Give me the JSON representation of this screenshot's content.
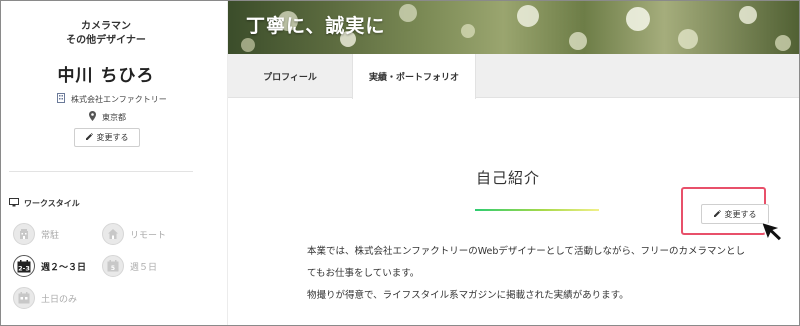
{
  "profile": {
    "job_line1": "カメラマン",
    "job_line2": "その他デザイナー",
    "name": "中川 ちひろ",
    "company": "株式会社エンファクトリー",
    "location": "東京都",
    "edit_label": "変更する"
  },
  "workstyle": {
    "title": "ワークスタイル",
    "items": [
      {
        "label": "常駐",
        "icon": "building-icon",
        "active": false
      },
      {
        "label": "リモート",
        "icon": "house-icon",
        "active": false
      },
      {
        "label": "週２〜３日",
        "icon": "calendar-2-3-icon",
        "active": true
      },
      {
        "label": "週５日",
        "icon": "calendar-5-icon",
        "active": false
      },
      {
        "label": "土日のみ",
        "icon": "calendar-weekend-icon",
        "active": false
      }
    ]
  },
  "hero": {
    "title": "丁寧に、誠実に"
  },
  "tabs": [
    {
      "label": "プロフィール"
    },
    {
      "label": "実績・ポートフォリオ"
    }
  ],
  "intro_section": {
    "title": "自己紹介",
    "edit_label": "変更する",
    "lines": [
      "本業では、株式会社エンファクトリーのWebデザイナーとして活動しながら、フリーのカメラマンとし",
      "てもお仕事をしています。",
      "物撮りが得意で、ライフスタイル系マガジンに掲載された実績があります。"
    ]
  },
  "colors": {
    "highlight": "#e8506a",
    "line_start": "#2ecc71",
    "line_end": "#f1f08a"
  }
}
